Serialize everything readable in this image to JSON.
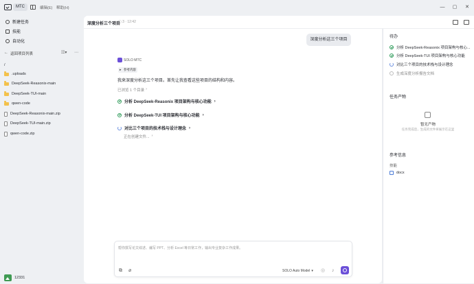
{
  "app": {
    "name": "MTC"
  },
  "menu": {
    "items": [
      "编辑(E)",
      "帮助(H)"
    ]
  },
  "window_controls": {
    "minimize": "—",
    "maximize": "▢",
    "close": "✕"
  },
  "sidebar": {
    "nav": [
      {
        "label": "新建任务",
        "icon": "plus-circle-icon"
      },
      {
        "label": "技能",
        "icon": "skill-icon"
      },
      {
        "label": "自动化",
        "icon": "clock-icon"
      }
    ],
    "back_label": "返回项目列表",
    "files": [
      {
        "name": "/",
        "type": "root"
      },
      {
        "name": ".uploads",
        "type": "folder"
      },
      {
        "name": "DeepSeek-Reasonix-main",
        "type": "folder"
      },
      {
        "name": "DeepSeek-TUI-main",
        "type": "folder"
      },
      {
        "name": "qwen-code",
        "type": "folder"
      },
      {
        "name": "DeepSeek-Reasonix-main.zip",
        "type": "zip"
      },
      {
        "name": "DeepSeek-TUI-main.zip",
        "type": "zip"
      },
      {
        "name": "qwen-code.zip",
        "type": "zip"
      }
    ],
    "user": {
      "name": "12331"
    }
  },
  "header": {
    "title": "深度分析三个项目",
    "meta": "3 · 12:42"
  },
  "chat": {
    "user_message": "深度分析这三个项目",
    "agent_name": "SOLO MTC",
    "ref_tag": "参考内容",
    "agent_text": "我来深度分析这三个项目。首先让我查看这些项目的结构和内容。",
    "viewed": "已浏览 1 个目录",
    "steps": [
      {
        "label": "分析 DeepSeek-Reasonix 项目架构与核心功能",
        "status": "done"
      },
      {
        "label": "分析 DeepSeek-TUI 项目架构与核心功能",
        "status": "done"
      },
      {
        "label": "对比三个项目的技术栈与设计理念",
        "status": "running"
      }
    ],
    "progress_text": "正在创建文件..."
  },
  "input": {
    "placeholder": "帮你撰写论文综述、编写 PPT、分析 Excel 等日常工作，输出专业复杂工作成果。",
    "model": "SOLO Auto Model"
  },
  "right_panel": {
    "todo_title": "待办",
    "todos": [
      {
        "label": "分析 DeepSeek-Reasonix 项目架构与核心...",
        "status": "done"
      },
      {
        "label": "分析 DeepSeek-TUI 项目架构与核心功能",
        "status": "done"
      },
      {
        "label": "对比三个项目的技术栈与设计理念",
        "status": "running"
      },
      {
        "label": "生成深度分析报告文档",
        "status": "pending"
      }
    ],
    "output_title": "任务产物",
    "empty_title": "暂无产物",
    "empty_desc": "任务完成后，生成的文件将展示在这里",
    "ref_title": "参考信息",
    "skill_label": "技能",
    "skill_item": "docx"
  },
  "colors": {
    "accent": "#6b4fd8",
    "done": "#2f9b5a",
    "folder": "#f3c14b",
    "running": "#6b8fe0"
  }
}
